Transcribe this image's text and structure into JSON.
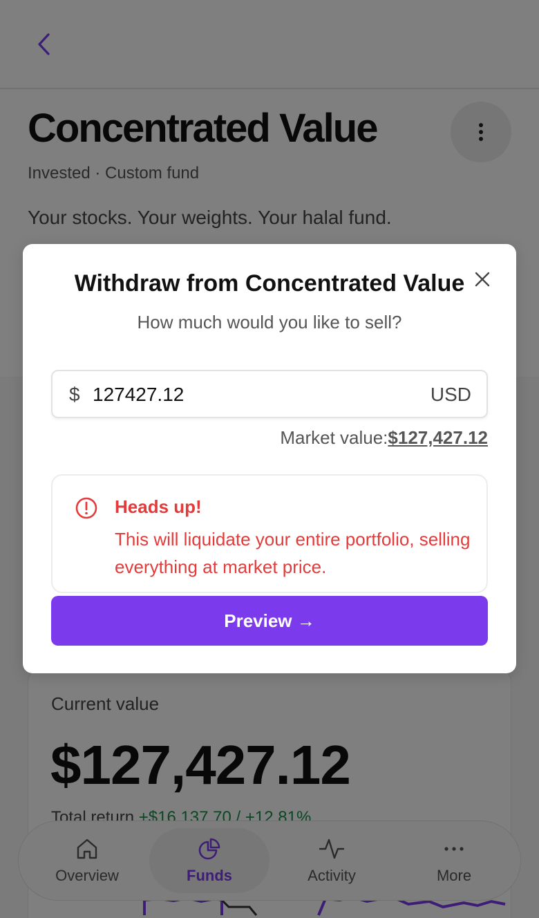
{
  "header": {
    "back_icon": "chevron-left-icon",
    "title": "Concentrated Value",
    "menu_icon": "more-vertical-icon",
    "meta": "Invested · Custom fund",
    "description": "Your stocks. Your weights. Your halal fund."
  },
  "value_card": {
    "label": "Current value",
    "amount": "$127,427.12",
    "return_label": "Total return",
    "return_value": "+$16,137.70 / +12.81%"
  },
  "bottom_nav": {
    "items": [
      {
        "label": "Overview",
        "icon": "home-icon",
        "active": false
      },
      {
        "label": "Funds",
        "icon": "pie-chart-icon",
        "active": true
      },
      {
        "label": "Activity",
        "icon": "activity-icon",
        "active": false
      },
      {
        "label": "More",
        "icon": "more-horizontal-icon",
        "active": false
      }
    ]
  },
  "modal": {
    "title": "Withdraw from Concentrated Value",
    "subtitle": "How much would you like to sell?",
    "currency_symbol": "$",
    "amount_value": "127427.12",
    "currency_code": "USD",
    "market_label": "Market value:",
    "market_value": "$127,427.12",
    "warning_title": "Heads up!",
    "warning_text": "This will liquidate your entire portfolio, selling everything at market price.",
    "preview_label": "Preview →"
  },
  "colors": {
    "accent": "#7c3aed",
    "warning": "#e23b3b",
    "positive": "#1a8d4a"
  }
}
